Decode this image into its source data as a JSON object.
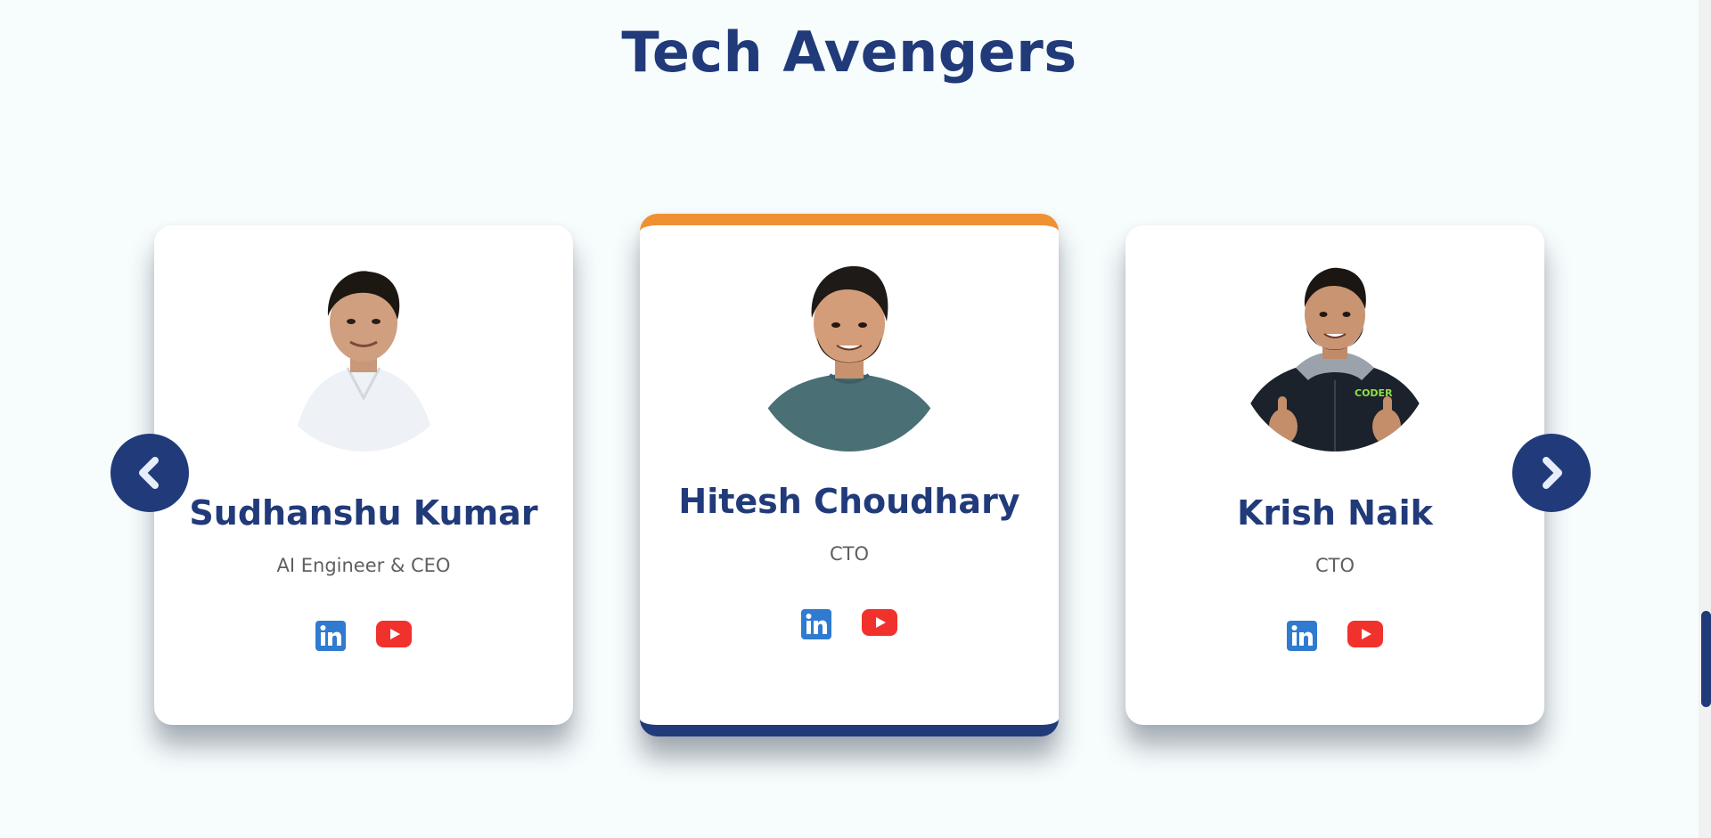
{
  "section": {
    "title": "Tech Avengers"
  },
  "carousel": {
    "prev_icon": "chevron-left-icon",
    "next_icon": "chevron-right-icon"
  },
  "members": [
    {
      "name": "Sudhanshu Kumar",
      "role": "AI Engineer & CEO",
      "shirt": "white-shirt",
      "featured": false
    },
    {
      "name": "Hitesh Choudhary",
      "role": "CTO",
      "shirt": "teal-tshirt",
      "featured": true
    },
    {
      "name": "Krish Naik",
      "role": "CTO",
      "shirt": "black-hoodie",
      "hoodie_text": "CODER",
      "featured": false
    }
  ],
  "social_icons": [
    "linkedin-icon",
    "youtube-icon"
  ],
  "colors": {
    "primary": "#213a7a",
    "accent": "#ef9132",
    "linkedin": "#2f7bd0",
    "youtube": "#f1322c",
    "background": "#f7fcfd"
  }
}
